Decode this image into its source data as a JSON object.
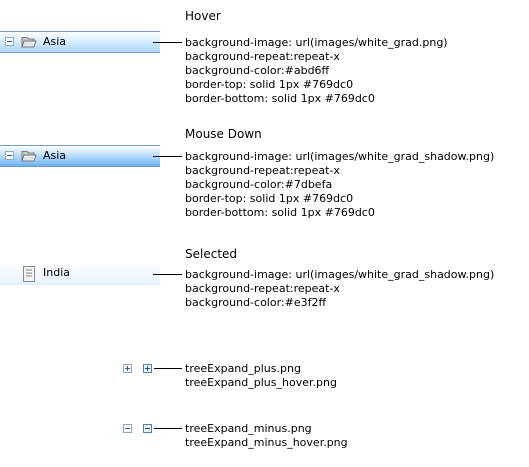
{
  "sections": {
    "hover": {
      "title": "Hover",
      "node_label": "Asia",
      "styles": [
        "background-image: url(images/white_grad.png)",
        "background-repeat:repeat-x",
        "background-color:#abd6ff",
        "border-top: solid 1px #769dc0",
        "border-bottom: solid 1px #769dc0"
      ]
    },
    "mouse_down": {
      "title": "Mouse Down",
      "node_label": "Asia",
      "styles": [
        "background-image: url(images/white_grad_shadow.png)",
        "background-repeat:repeat-x",
        "background-color:#7dbefa",
        "border-top: solid 1px #769dc0",
        "border-bottom: solid 1px #769dc0"
      ]
    },
    "selected": {
      "title": "Selected",
      "node_label": "India",
      "styles": [
        "background-image: url(images/white_grad_shadow.png)",
        "background-repeat:repeat-x",
        "background-color:#e3f2ff"
      ]
    }
  },
  "expand_icons": {
    "plus": [
      "treeExpand_plus.png",
      "treeExpand_plus_hover.png"
    ],
    "minus": [
      "treeExpand_minus.png",
      "treeExpand_minus_hover.png"
    ]
  },
  "colors": {
    "hover_bg": "#abd6ff",
    "mouse_down_bg": "#7dbefa",
    "selected_bg": "#e3f2ff",
    "border": "#769dc0"
  },
  "icons": {
    "collapse": "minus-box-icon",
    "expand": "plus-box-icon",
    "folder": "open-folder-icon",
    "page": "page-icon"
  }
}
